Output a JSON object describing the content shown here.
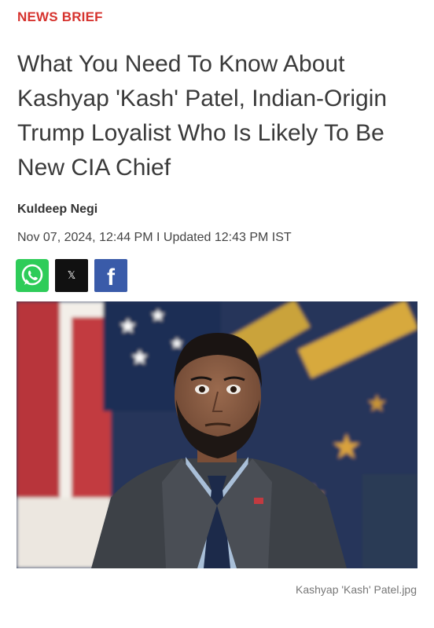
{
  "article": {
    "kicker": "NEWS BRIEF",
    "headline": "What You Need To Know About Kashyap 'Kash' Patel, Indian-Origin Trump Loyalist Who Is Likely To Be New CIA Chief",
    "author": "Kuldeep Negi",
    "dateline": "Nov 07, 2024, 12:44 PM I Updated 12:43 PM IST"
  },
  "share": {
    "whatsapp_icon": "whatsapp-icon",
    "x_icon": "x-icon",
    "x_glyph": "𝕏",
    "facebook_icon": "facebook-icon",
    "facebook_glyph": "f"
  },
  "image": {
    "caption": "Kashyap 'Kash' Patel.jpg"
  },
  "colors": {
    "kicker": "#d6332e",
    "whatsapp": "#2ecc59",
    "x": "#111111",
    "facebook": "#3a5ba9"
  }
}
